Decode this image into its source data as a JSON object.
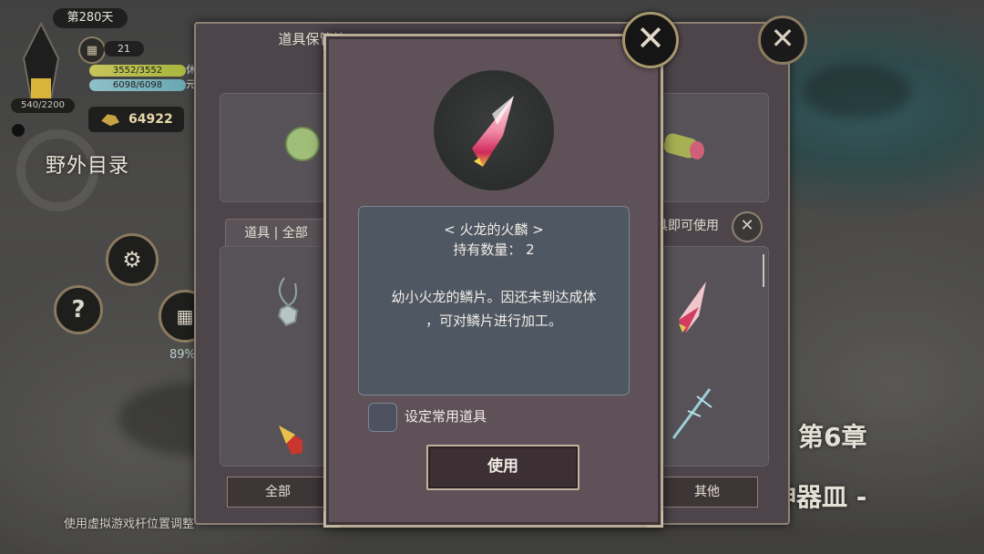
{
  "hud": {
    "day": "第280天",
    "crystal_count": "540/2200",
    "calendar_value": "21",
    "hp": "3552/3552",
    "mp": "6098/6098",
    "hp_suffix": "休",
    "mp_suffix": "元",
    "gold": "64922",
    "field_directory": "野外目录",
    "help": "?",
    "percent": "89%"
  },
  "storage": {
    "title": "道具保管箱",
    "tab": "道具 | 全部",
    "use_hint": "具即可使用",
    "categories": [
      "全部",
      "其他"
    ]
  },
  "modal": {
    "item_name": "< 火龙的火麟 >",
    "quantity_line": "持有数量： 2",
    "description_line1": "幼小火龙的鳞片。因还未到达成体",
    "description_line2": "，可对鳞片进行加工。",
    "checkbox_label": "设定常用道具",
    "use_button": "使用"
  },
  "background": {
    "chapter": "第6章",
    "chapter_subtitle": "神器皿 -",
    "joystick_hint": "使用虚拟游戏杆位置调整"
  },
  "colors": {
    "modal_bg": "#5e5158",
    "description_bg": "#4f5763",
    "frame_gold": "#b6aa96"
  }
}
